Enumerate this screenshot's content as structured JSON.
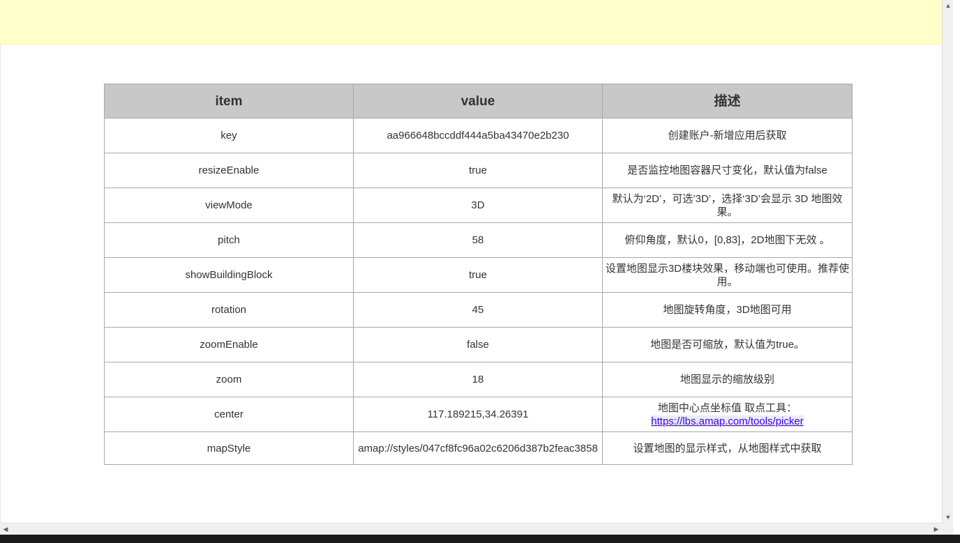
{
  "table": {
    "headers": [
      "item",
      "value",
      "描述"
    ],
    "rows": [
      {
        "item": "key",
        "value": "aa966648bccddf444a5ba43470e2b230",
        "desc": "创建账户-新增应用后获取"
      },
      {
        "item": "resizeEnable",
        "value": "true",
        "desc": "是否监控地图容器尺寸变化，默认值为false"
      },
      {
        "item": "viewMode",
        "value": "3D",
        "desc": "默认为‘2D’，可选’3D’，选择‘3D’会显示 3D 地图效果。"
      },
      {
        "item": "pitch",
        "value": "58",
        "desc": "俯仰角度，默认0，[0,83]，2D地图下无效 。"
      },
      {
        "item": "showBuildingBlock",
        "value": "true",
        "desc": "设置地图显示3D楼块效果，移动端也可使用。推荐使用。"
      },
      {
        "item": "rotation",
        "value": "45",
        "desc": "地图旋转角度，3D地图可用"
      },
      {
        "item": "zoomEnable",
        "value": "false",
        "desc": "地图是否可缩放，默认值为true。"
      },
      {
        "item": "zoom",
        "value": "18",
        "desc": "地图显示的缩放级别"
      },
      {
        "item": "center",
        "value": "117.189215,34.26391",
        "desc_prefix": "地图中心点坐标值 取点工具：",
        "link": "https://lbs.amap.com/tools/picker"
      },
      {
        "item": "mapStyle",
        "value": "amap://styles/047cf8fc96a02c6206d387b2feac3858",
        "desc": "设置地图的显示样式，从地图样式中获取"
      }
    ]
  },
  "colors": {
    "banner": "#ffffcc",
    "header_bg": "#c8c8c8",
    "link": "#3a00ff"
  },
  "icons": {
    "scroll_up": "triangle-up",
    "scroll_down": "triangle-down",
    "scroll_left": "triangle-left",
    "scroll_right": "triangle-right"
  }
}
